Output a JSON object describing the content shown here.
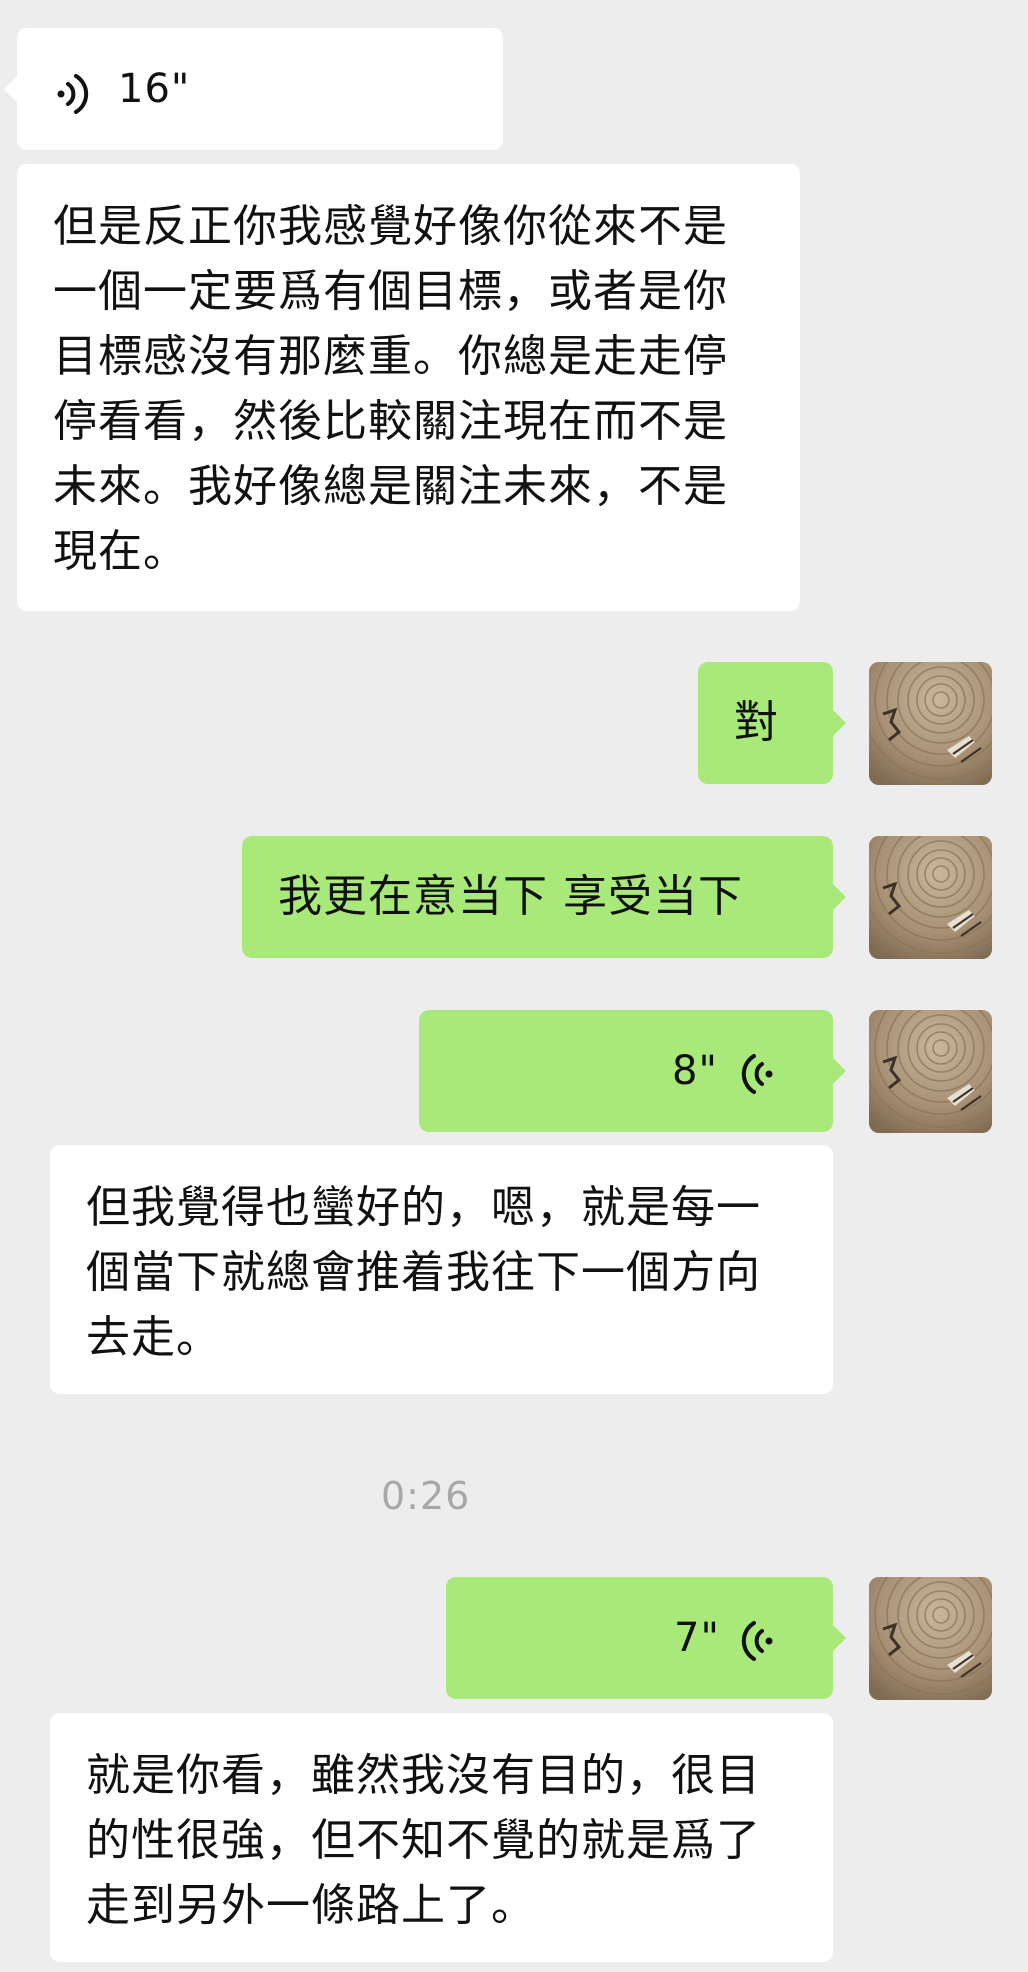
{
  "chat": {
    "messages": [
      {
        "type": "voice",
        "side": "incoming",
        "duration": "16\""
      },
      {
        "type": "text",
        "side": "incoming",
        "text": "但是反正你我感覺好像你從來不是一個一定要爲有個目標，或者是你目標感沒有那麼重。你總是走走停停看看，然後比較關注現在而不是未來。我好像總是關注未來，不是現在。"
      },
      {
        "type": "text",
        "side": "outgoing",
        "text": "對"
      },
      {
        "type": "text",
        "side": "outgoing",
        "text": "我更在意当下 享受当下"
      },
      {
        "type": "voice",
        "side": "outgoing",
        "duration": "8\""
      },
      {
        "type": "text",
        "side": "incoming",
        "text": "但我覺得也蠻好的，嗯，就是每一個當下就總會推着我往下一個方向去走。"
      },
      {
        "type": "timestamp",
        "text": "0:26"
      },
      {
        "type": "voice",
        "side": "outgoing",
        "duration": "7\""
      },
      {
        "type": "text",
        "side": "incoming",
        "text": "就是你看，雖然我沒有目的，很目的性很強，但不知不覺的就是爲了走到另外一條路上了。"
      }
    ]
  },
  "colors": {
    "background": "#ededed",
    "incoming_bubble": "#ffffff",
    "outgoing_bubble": "#a9e97a",
    "timestamp_text": "#a8a8a8"
  },
  "icons": {
    "voice_incoming": "voice-wave-right-icon",
    "voice_outgoing": "voice-wave-left-icon",
    "avatar": "wood-texture-avatar"
  }
}
